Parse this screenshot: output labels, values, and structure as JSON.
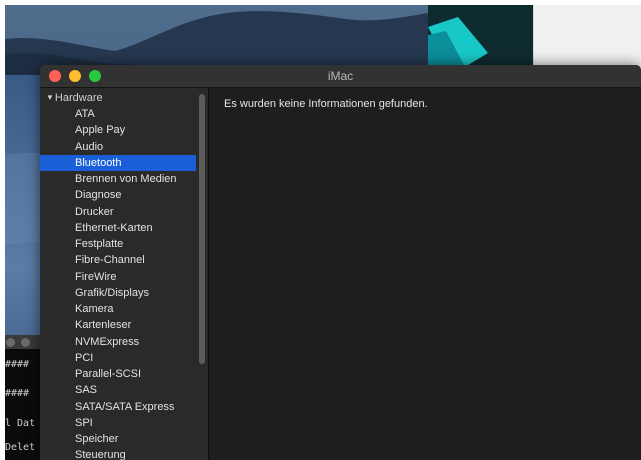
{
  "window": {
    "title": "iMac"
  },
  "sidebar": {
    "section_header": "Hardware",
    "selected_index": 3,
    "items": [
      "ATA",
      "Apple Pay",
      "Audio",
      "Bluetooth",
      "Brennen von Medien",
      "Diagnose",
      "Drucker",
      "Ethernet-Karten",
      "Festplatte",
      "Fibre-Channel",
      "FireWire",
      "Grafik/Displays",
      "Kamera",
      "Kartenleser",
      "NVMExpress",
      "PCI",
      "Parallel-SCSI",
      "SAS",
      "SATA/SATA Express",
      "SPI",
      "Speicher",
      "Steuerung"
    ]
  },
  "content": {
    "message": "Es wurden keine Informationen gefunden."
  },
  "terminal": {
    "lines": [
      "####",
      "####",
      "l Dat",
      "Delet"
    ]
  },
  "colors": {
    "selection": "#1a5fd8",
    "close": "#fe5f57",
    "minimize": "#febc2e",
    "zoom": "#28c840",
    "window_bg": "#1e1e1e",
    "sidebar_bg": "#2a2a2a"
  },
  "icons": {
    "disclosure": "disclosure-triangle-down-icon"
  }
}
